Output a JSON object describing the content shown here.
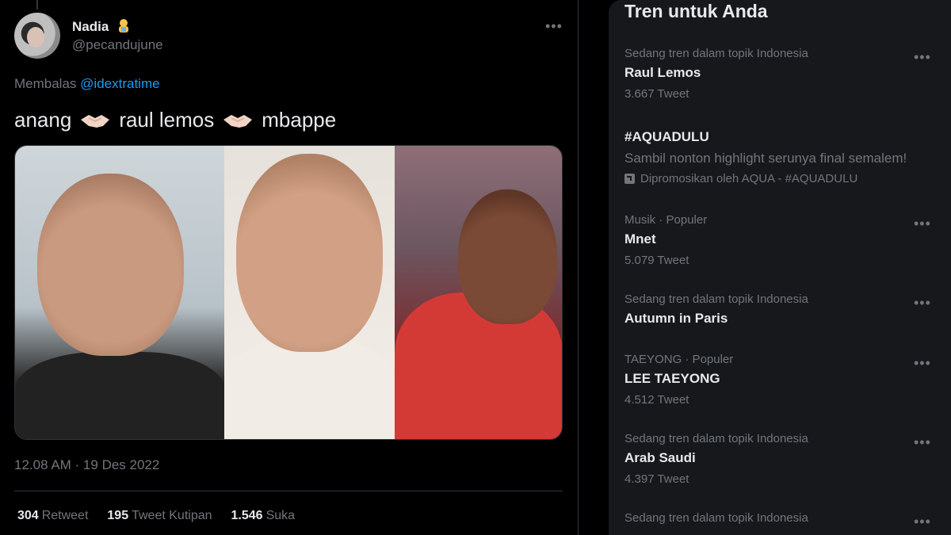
{
  "tweet": {
    "display_name": "Nadia",
    "handle": "@pecandujune",
    "reply_prefix": "Membalas",
    "reply_to": "@idextratime",
    "text_parts": [
      "anang",
      "raul lemos",
      "mbappe"
    ],
    "timestamp": "12.08 AM · 19 Des 2022",
    "stats": [
      {
        "value": "304",
        "label": "Retweet"
      },
      {
        "value": "195",
        "label": "Tweet Kutipan"
      },
      {
        "value": "1.546",
        "label": "Suka"
      }
    ],
    "icons": {
      "more": "more-horizontal-icon",
      "emoji": "person-emoji-icon",
      "separator": "handshake-emoji-icon"
    }
  },
  "trends": {
    "title": "Tren untuk Anda",
    "items": [
      {
        "context": "Sedang tren dalam topik Indonesia",
        "name": "Raul Lemos",
        "count": "3.667 Tweet"
      },
      {
        "name": "#AQUADULU",
        "description": "Sambil nonton highlight serunya final semalem!",
        "promoted": "Dipromosikan oleh AQUA - #AQUADULU"
      },
      {
        "context": "Musik · Populer",
        "name": "Mnet",
        "count": "5.079 Tweet"
      },
      {
        "context": "Sedang tren dalam topik Indonesia",
        "name": "Autumn in Paris"
      },
      {
        "context": "TAEYONG · Populer",
        "name": "LEE TAEYONG",
        "count": "4.512 Tweet"
      },
      {
        "context": "Sedang tren dalam topik Indonesia",
        "name": "Arab Saudi",
        "count": "4.397 Tweet"
      },
      {
        "context": "Sedang tren dalam topik Indonesia"
      }
    ]
  },
  "colors": {
    "background": "#000000",
    "panel": "#16181c",
    "text": "#e7e9ea",
    "muted": "#71767b",
    "link": "#1d9bf0"
  }
}
